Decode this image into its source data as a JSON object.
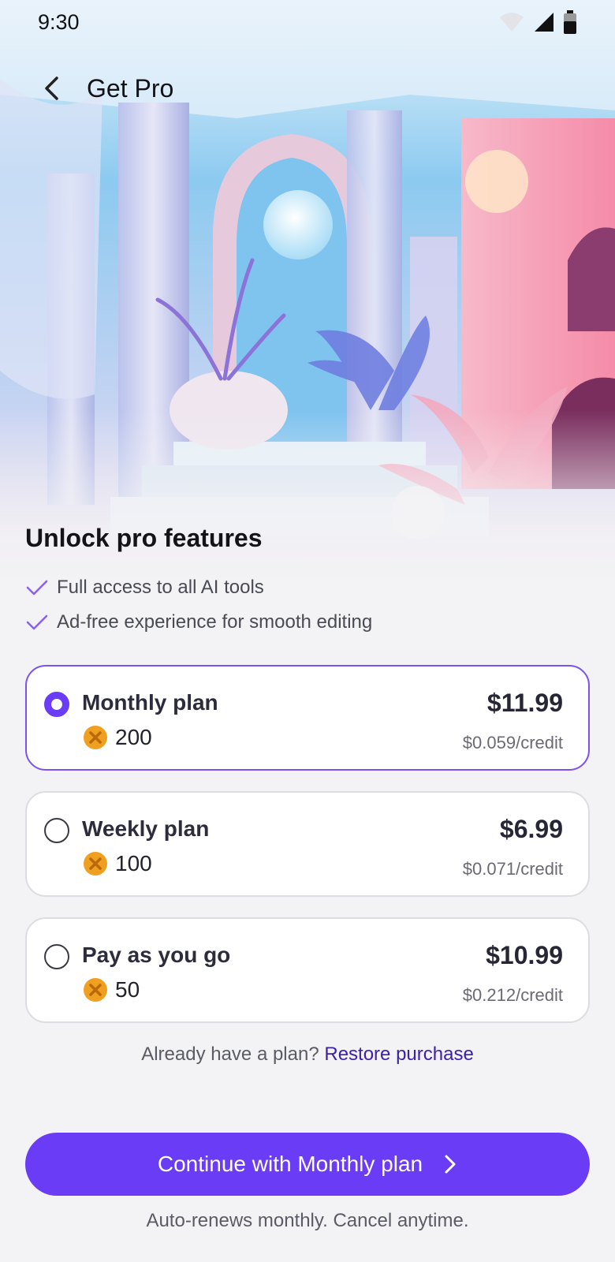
{
  "status_bar": {
    "time": "9:30",
    "icons": [
      "wifi-icon",
      "signal-icon",
      "battery-icon"
    ]
  },
  "app_bar": {
    "title": "Get Pro",
    "back_icon": "back-arrow-icon"
  },
  "hero": {
    "image": "dreamy pastel palace courtyard with columns and plants"
  },
  "headline": "Unlock pro features",
  "features": [
    "Full access to all AI tools",
    "Ad-free experience for smooth editing"
  ],
  "plans": [
    {
      "name": "Monthly plan",
      "credits": "200",
      "price": "$11.99",
      "unit_price": "$0.059/credit",
      "selected": true
    },
    {
      "name": "Weekly plan",
      "credits": "100",
      "price": "$6.99",
      "unit_price": "$0.071/credit",
      "selected": false
    },
    {
      "name": "Pay as you go",
      "credits": "50",
      "price": "$10.99",
      "unit_price": "$0.212/credit",
      "selected": false
    }
  ],
  "restore": {
    "prompt": "Already have a plan?",
    "link": "Restore purchase"
  },
  "cta": {
    "label": "Continue with Monthly plan"
  },
  "footnote": "Auto-renews monthly. Cancel anytime.",
  "colors": {
    "accent": "#6a3cf5",
    "selected_border": "#7b52f0",
    "coin": "#f0a020",
    "link": "#3d1fa8"
  }
}
